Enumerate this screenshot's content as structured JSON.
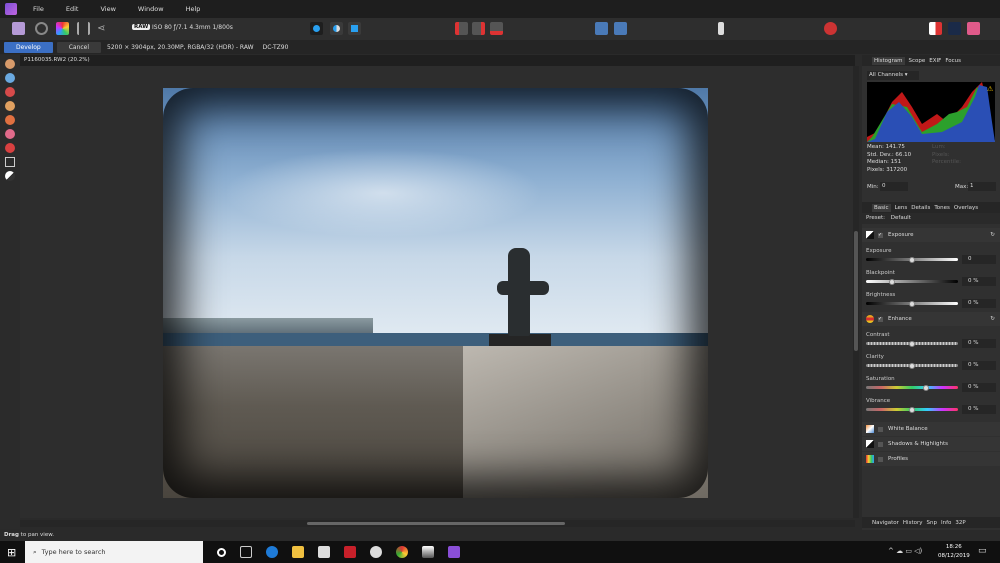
{
  "menu": [
    "File",
    "Edit",
    "View",
    "Window",
    "Help"
  ],
  "toolbar": {
    "raw_badge": "RAW",
    "exif": "ISO 80 ƒ/7.1 4.3mm 1/800s"
  },
  "context": {
    "develop": "Develop",
    "cancel": "Cancel",
    "info": "5200 × 3904px, 20.30MP, RGBA/32 (HDR) - RAW",
    "camera": "DC-TZ90"
  },
  "document": {
    "tab": "P1160035.RW2 (20.2%)"
  },
  "status": {
    "bold": "Drag",
    "text": " to pan view."
  },
  "histogram": {
    "tabs": [
      "Histogram",
      "Scope",
      "EXIF",
      "Focus"
    ],
    "channel": "All Channels",
    "stats": [
      "Mean: 141.75",
      "Std. Dev.: 66.10",
      "Median: 151",
      "Pixels: 317200"
    ],
    "dim_stats": [
      "Lum:",
      "Pixels:",
      "Percentile:"
    ],
    "min_label": "Min:",
    "min": "0",
    "max_label": "Max:",
    "max": "1"
  },
  "develop": {
    "tabs": [
      "Basic",
      "Lens",
      "Details",
      "Tones",
      "Overlays"
    ],
    "preset_label": "Preset:",
    "preset": "Default",
    "exposure": {
      "title": "Exposure",
      "sliders": [
        {
          "label": "Exposure",
          "value": "0",
          "pos": 0.5
        },
        {
          "label": "Blackpoint",
          "value": "0 %",
          "pos": 0.28
        },
        {
          "label": "Brightness",
          "value": "0 %",
          "pos": 0.5
        }
      ]
    },
    "enhance": {
      "title": "Enhance",
      "sliders": [
        {
          "label": "Contrast",
          "value": "0 %",
          "pos": 0.5
        },
        {
          "label": "Clarity",
          "value": "0 %",
          "pos": 0.5
        },
        {
          "label": "Saturation",
          "value": "0 %",
          "pos": 0.65
        },
        {
          "label": "Vibrance",
          "value": "0 %",
          "pos": 0.5
        }
      ]
    },
    "sections": [
      "White Balance",
      "Shadows & Highlights",
      "Profiles"
    ]
  },
  "bottom_tabs": [
    "Navigator",
    "History",
    "Snp",
    "Info",
    "32P"
  ],
  "taskbar": {
    "search_placeholder": "Type here to search",
    "time": "18:26",
    "date": "08/12/2019"
  }
}
